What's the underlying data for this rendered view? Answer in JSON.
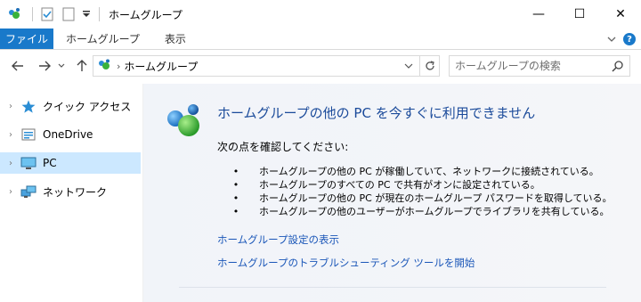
{
  "window": {
    "title": "ホームグループ",
    "controls": {
      "minimize": "—",
      "maximize": "☐",
      "close": "✕"
    }
  },
  "ribbon": {
    "tabs": [
      "ファイル",
      "ホームグループ",
      "表示"
    ],
    "expand_icon": "chevron-down-icon",
    "help_icon": "help-icon"
  },
  "address": {
    "breadcrumb": "ホームグループ",
    "separator": "›",
    "search_placeholder": "ホームグループの検索"
  },
  "nav_pane": {
    "items": [
      {
        "label": "クイック アクセス",
        "icon": "star-icon"
      },
      {
        "label": "OneDrive",
        "icon": "onedrive-icon"
      },
      {
        "label": "PC",
        "icon": "pc-icon",
        "selected": true
      },
      {
        "label": "ネットワーク",
        "icon": "network-icon"
      }
    ]
  },
  "content": {
    "heading": "ホームグループの他の PC を今すぐに利用できません",
    "lead": "次の点を確認してください:",
    "bullets": [
      "ホームグループの他の PC が稼働していて、ネットワークに接続されている。",
      "ホームグループのすべての PC で共有がオンに設定されている。",
      "ホームグループの他の PC が現在のホームグループ パスワードを取得している。",
      "ホームグループの他のユーザーがホームグループでライブラリを共有している。"
    ],
    "bullet_char": "•",
    "links": [
      "ホームグループ設定の表示",
      "ホームグループのトラブルシューティング ツールを開始"
    ]
  },
  "colors": {
    "accent": "#1979ca",
    "heading": "#1a4a9a",
    "link": "#1a56b8",
    "selected": "#cce8ff"
  }
}
